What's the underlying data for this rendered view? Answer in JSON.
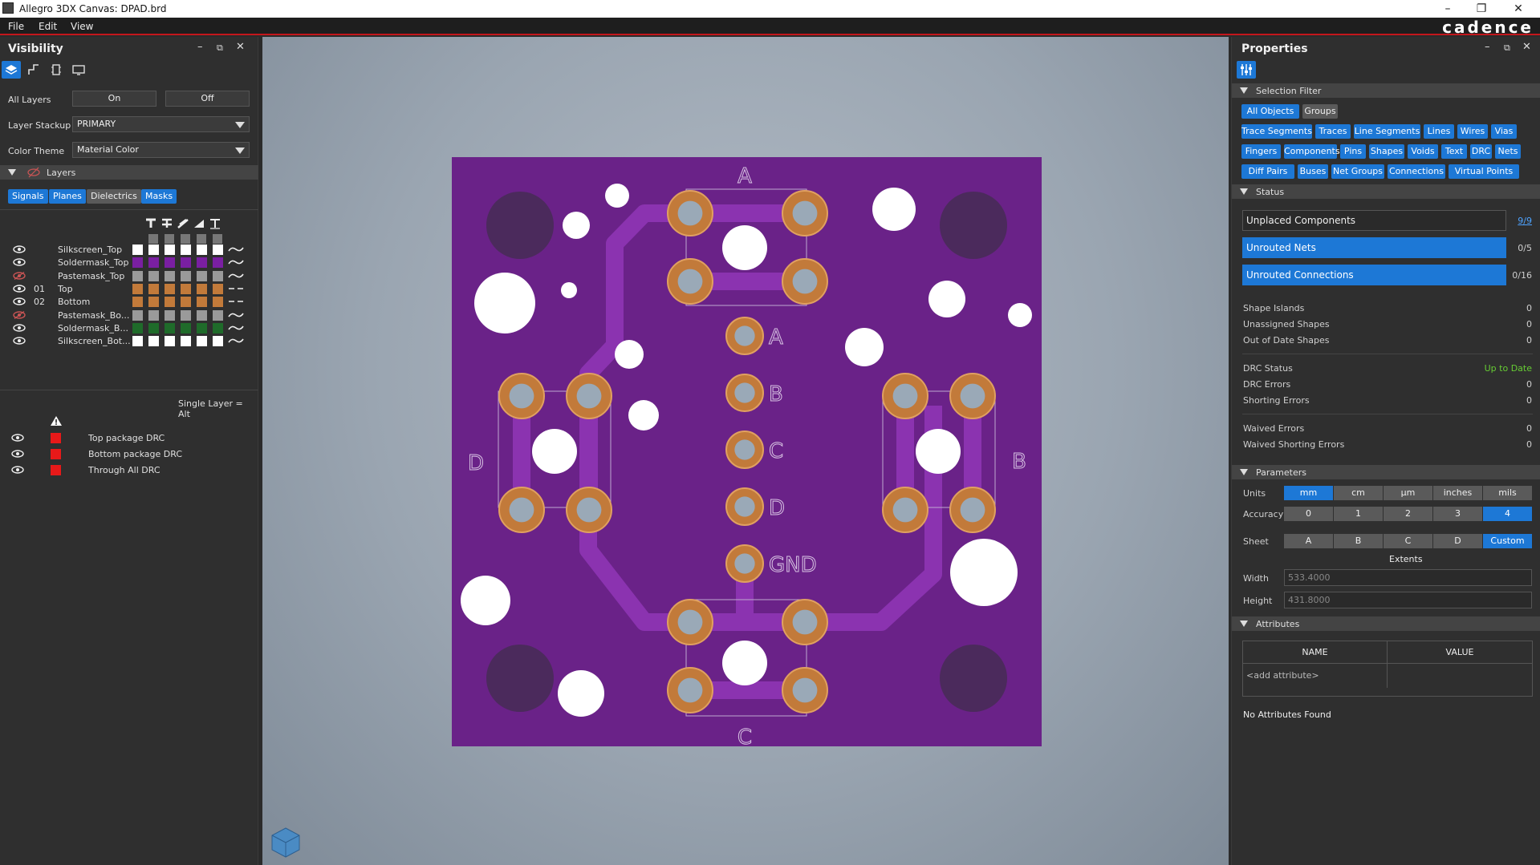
{
  "window": {
    "title": "Allegro 3DX Canvas: DPAD.brd",
    "logo": "cadence"
  },
  "menu": [
    "File",
    "Edit",
    "View"
  ],
  "visibility": {
    "title": "Visibility",
    "all_layers_label": "All Layers",
    "on_label": "On",
    "off_label": "Off",
    "layer_stackup_label": "Layer Stackup",
    "layer_stackup_value": "PRIMARY",
    "color_theme_label": "Color Theme",
    "color_theme_value": "Material Color",
    "layers_section": "Layers",
    "filters": [
      "Signals",
      "Planes",
      "Dielectrics",
      "Masks"
    ],
    "layers": [
      {
        "num": "",
        "name": "Silkscreen_Top",
        "color": "#ffffff",
        "visible": true,
        "line": "wave"
      },
      {
        "num": "",
        "name": "Soldermask_Top",
        "color": "#7a1fa2",
        "visible": true,
        "line": "wave"
      },
      {
        "num": "",
        "name": "Pastemask_Top",
        "color": "#9a9a9a",
        "visible": false,
        "line": "wave"
      },
      {
        "num": "01",
        "name": "Top",
        "color": "#c27a3a",
        "visible": true,
        "line": "dash"
      },
      {
        "num": "02",
        "name": "Bottom",
        "color": "#c27a3a",
        "visible": true,
        "line": "dash"
      },
      {
        "num": "",
        "name": "Pastemask_Bo...",
        "color": "#9a9a9a",
        "visible": false,
        "line": "wave"
      },
      {
        "num": "",
        "name": "Soldermask_B...",
        "color": "#1f6b2a",
        "visible": true,
        "line": "wave"
      },
      {
        "num": "",
        "name": "Silkscreen_Bot...",
        "color": "#ffffff",
        "visible": true,
        "line": "wave"
      }
    ],
    "single_layer_hint": "Single Layer = Alt",
    "drc": [
      {
        "name": "Top package DRC",
        "color": "#e81919"
      },
      {
        "name": "Bottom package DRC",
        "color": "#e81919"
      },
      {
        "name": "Through All DRC",
        "color": "#e81919"
      }
    ]
  },
  "board": {
    "labels": {
      "top": "A",
      "right": "B",
      "bottom": "C",
      "left": "D"
    },
    "center_pads": [
      "A",
      "B",
      "C",
      "D",
      "GND"
    ],
    "colors": {
      "board": "#6a2288",
      "trace": "#8b33b0",
      "pad": "#c27a3a",
      "drill": "#9aa9b7",
      "hole": "#ffffff",
      "dark": "#4b2a5c"
    }
  },
  "properties": {
    "title": "Properties",
    "selection_filter": "Selection Filter",
    "filter_chips": [
      {
        "label": "All Objects",
        "active": true
      },
      {
        "label": "Groups",
        "active": false
      },
      {
        "label": "Trace Segments",
        "active": true
      },
      {
        "label": "Traces",
        "active": true
      },
      {
        "label": "Line Segments",
        "active": true
      },
      {
        "label": "Lines",
        "active": true
      },
      {
        "label": "Wires",
        "active": true
      },
      {
        "label": "Vias",
        "active": true
      },
      {
        "label": "Fingers",
        "active": true
      },
      {
        "label": "Components",
        "active": true
      },
      {
        "label": "Pins",
        "active": true
      },
      {
        "label": "Shapes",
        "active": true
      },
      {
        "label": "Voids",
        "active": true
      },
      {
        "label": "Text",
        "active": true
      },
      {
        "label": "DRC",
        "active": true
      },
      {
        "label": "Nets",
        "active": true
      },
      {
        "label": "Diff Pairs",
        "active": true
      },
      {
        "label": "Buses",
        "active": true
      },
      {
        "label": "Net Groups",
        "active": true
      },
      {
        "label": "Connections",
        "active": true
      },
      {
        "label": "Virtual Points",
        "active": true
      }
    ],
    "status_section": "Status",
    "status_boxes": [
      {
        "label": "Unplaced Components",
        "value": "9/9",
        "highlight": false
      },
      {
        "label": "Unrouted Nets",
        "value": "0/5",
        "highlight": true
      },
      {
        "label": "Unrouted Connections",
        "value": "0/16",
        "highlight": true
      }
    ],
    "status_rows": [
      {
        "label": "Shape Islands",
        "value": "0"
      },
      {
        "label": "Unassigned Shapes",
        "value": "0"
      },
      {
        "label": "Out of Date Shapes",
        "value": "0"
      },
      {
        "label": "DRC Status",
        "value": "Up to Date"
      },
      {
        "label": "DRC Errors",
        "value": "0"
      },
      {
        "label": "Shorting Errors",
        "value": "0"
      },
      {
        "label": "Waived Errors",
        "value": "0"
      },
      {
        "label": "Waived Shorting Errors",
        "value": "0"
      }
    ],
    "parameters_section": "Parameters",
    "units_label": "Units",
    "units": [
      "mm",
      "cm",
      "µm",
      "inches",
      "mils"
    ],
    "accuracy_label": "Accuracy",
    "accuracy": [
      "0",
      "1",
      "2",
      "3",
      "4"
    ],
    "sheet_label": "Sheet",
    "sheet": [
      "A",
      "B",
      "C",
      "D",
      "Custom"
    ],
    "extents_label": "Extents",
    "width_label": "Width",
    "width_value": "533.4000",
    "height_label": "Height",
    "height_value": "431.8000",
    "attributes_section": "Attributes",
    "attr_name_header": "NAME",
    "attr_value_header": "VALUE",
    "add_attribute": "<add attribute>",
    "no_attributes": "No Attributes Found"
  }
}
